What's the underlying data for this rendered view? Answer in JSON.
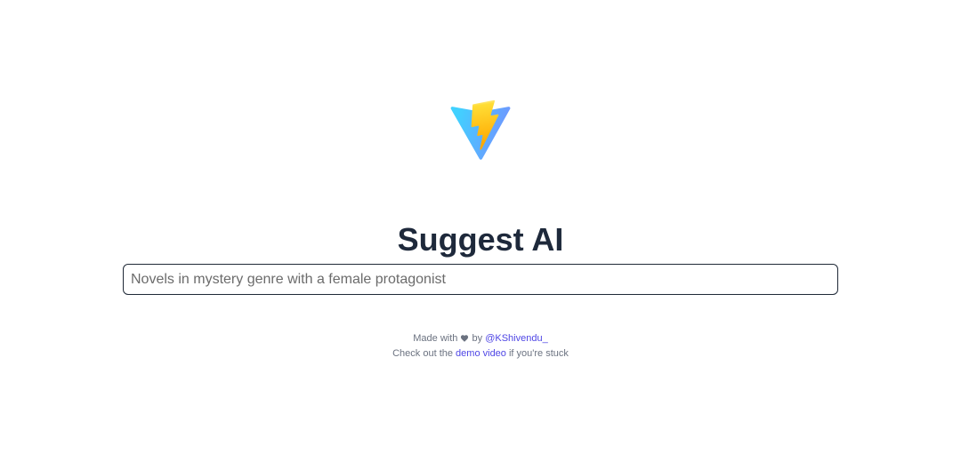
{
  "app": {
    "logo_icon": "vite-lightning-logo-icon",
    "title": "Suggest AI"
  },
  "search": {
    "placeholder": "Novels in mystery genre with a female protagonist",
    "value": ""
  },
  "footer": {
    "made_with_prefix": "Made with",
    "heart_icon": "heart-icon",
    "by_text": "by",
    "author_link": "@KShivendu_",
    "demo_prefix": "Check out the",
    "demo_link": "demo video",
    "demo_suffix": "if you're stuck"
  },
  "colors": {
    "title": "#1e293b",
    "link": "#4f46e5",
    "footer_text": "#6b7280",
    "input_border": "#1f2937"
  }
}
